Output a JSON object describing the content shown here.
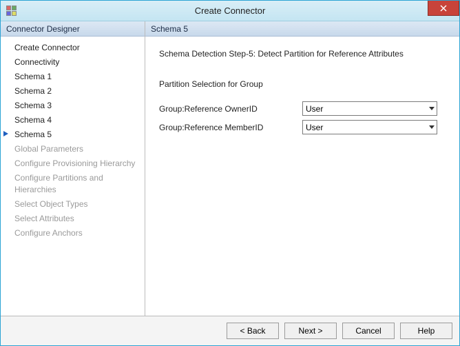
{
  "window": {
    "title": "Create Connector"
  },
  "sidebar": {
    "header": "Connector Designer",
    "items": [
      {
        "label": "Create Connector",
        "state": "enabled"
      },
      {
        "label": "Connectivity",
        "state": "enabled"
      },
      {
        "label": "Schema 1",
        "state": "enabled"
      },
      {
        "label": "Schema 2",
        "state": "enabled"
      },
      {
        "label": "Schema 3",
        "state": "enabled"
      },
      {
        "label": "Schema 4",
        "state": "enabled"
      },
      {
        "label": "Schema 5",
        "state": "active"
      },
      {
        "label": "Global Parameters",
        "state": "disabled"
      },
      {
        "label": "Configure Provisioning Hierarchy",
        "state": "disabled"
      },
      {
        "label": "Configure Partitions and Hierarchies",
        "state": "disabled"
      },
      {
        "label": "Select Object Types",
        "state": "disabled"
      },
      {
        "label": "Select Attributes",
        "state": "disabled"
      },
      {
        "label": "Configure Anchors",
        "state": "disabled"
      }
    ]
  },
  "content": {
    "header": "Schema 5",
    "step_title": "Schema Detection Step-5: Detect Partition for Reference Attributes",
    "section_title": "Partition Selection for Group",
    "rows": [
      {
        "label": "Group:Reference OwnerID",
        "value": "User"
      },
      {
        "label": "Group:Reference MemberID",
        "value": "User"
      }
    ]
  },
  "footer": {
    "back": "<  Back",
    "next": "Next  >",
    "cancel": "Cancel",
    "help": "Help"
  }
}
